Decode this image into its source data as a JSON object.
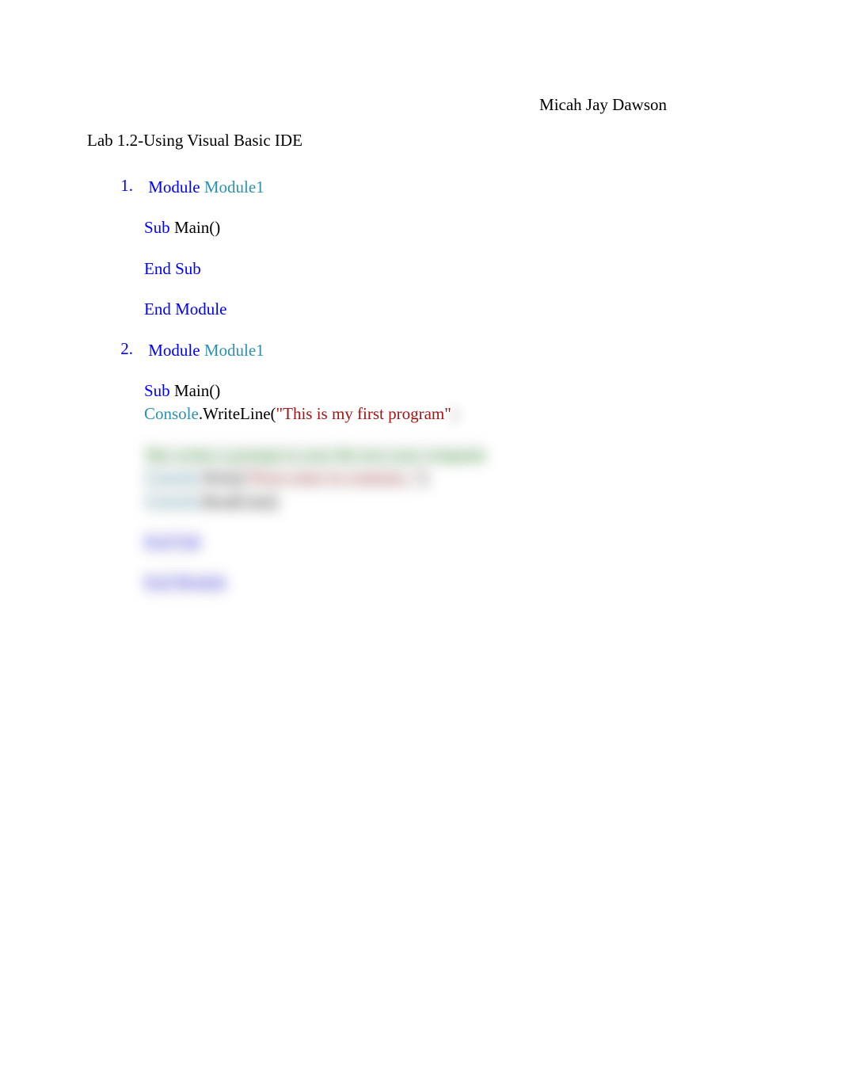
{
  "author": "Micah Jay Dawson",
  "title": "Lab 1.2-Using Visual Basic IDE",
  "list": {
    "num1": "1.",
    "num2": "2."
  },
  "code1": {
    "l1_a": "Module",
    "l1_b": " Module1",
    "l2_a": "Sub",
    "l2_b": " Main()",
    "l3": "End Sub",
    "l4": "End Module"
  },
  "code2": {
    "l1_a": "Module",
    "l1_b": " Module1",
    "l2_a": "Sub",
    "l2_b": " Main()",
    "l3_a": "Console",
    "l3_b": ".WriteLine(",
    "l3_c": "\"This is my first program\"",
    "l3_d": ")",
    "l4": "'this writes a prompt to your the text your computer",
    "l5_a": "Console",
    "l5_b": ".Write(",
    "l5_c": "\"Press enter to continue...\"",
    "l5_d": ")",
    "l6_a": "Console",
    "l6_b": ".ReadLine()",
    "l7": "End Sub",
    "l8": "End Module"
  }
}
